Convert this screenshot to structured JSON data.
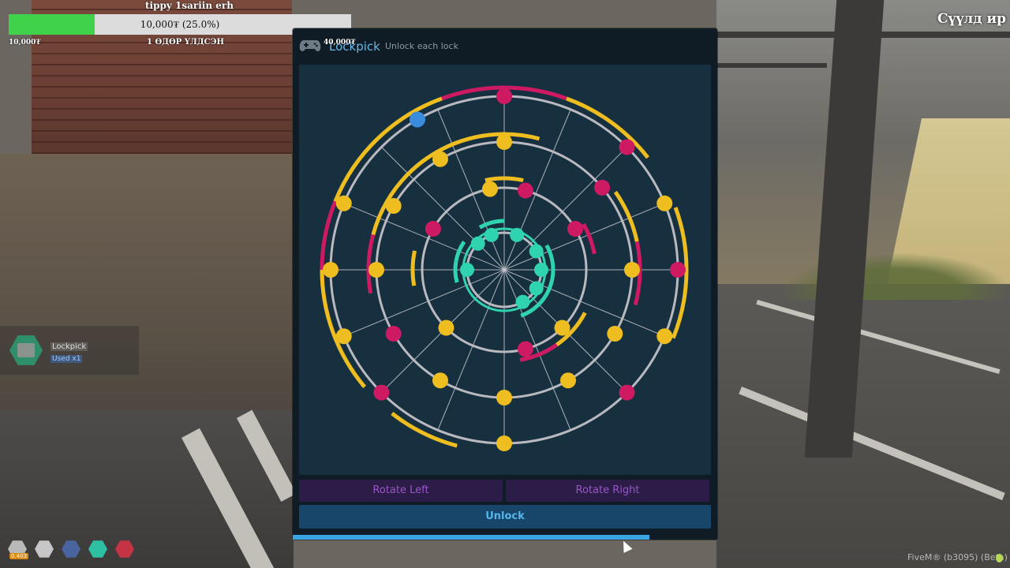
{
  "hud": {
    "player_name": "tippy 1sariin erh",
    "progress_text": "10,000₮ (25.0%)",
    "progress_fraction": 0.25,
    "left_amount": "10,000₮",
    "right_amount": "40,000₮",
    "sub_label": "1 ӨДӨР ҮЛДСЭН",
    "top_right_label": "Сүүлд ир"
  },
  "notification": {
    "item_name": "Lockpick",
    "item_action": "Used x1"
  },
  "status_bar": {
    "badge": "0.403",
    "icons": [
      "house-icon",
      "box-icon",
      "shield-icon",
      "drop-icon",
      "brain-icon"
    ],
    "colors": [
      "#b9b9b9",
      "#c6c6c6",
      "#4a64a0",
      "#2fbfa3",
      "#c43445"
    ]
  },
  "watermark": "FiveM® (b3095) (Beta)",
  "panel": {
    "title": "Lockpick",
    "subtitle": "Unlock each lock",
    "buttons": {
      "rotate_left": "Rotate Left",
      "rotate_right": "Rotate Right",
      "unlock": "Unlock"
    },
    "timer_fraction": 0.84,
    "colors": {
      "yellow": "#eebd1f",
      "magenta": "#cd1a63",
      "blue": "#3a8ddc",
      "teal": "#2fd3b0",
      "ring": "#b9b9bf",
      "spoke": "#c9c9cf"
    }
  },
  "lock": {
    "rings": [
      {
        "pins": [
          {
            "angle": 270,
            "color": "magenta"
          },
          {
            "angle": 315,
            "color": "magenta"
          },
          {
            "angle": 337.5,
            "color": "yellow"
          },
          {
            "angle": 0,
            "color": "magenta"
          },
          {
            "angle": 22.5,
            "color": "yellow"
          },
          {
            "angle": 45,
            "color": "magenta"
          },
          {
            "angle": 90,
            "color": "yellow"
          },
          {
            "angle": 135,
            "color": "magenta"
          },
          {
            "angle": 157.5,
            "color": "yellow"
          },
          {
            "angle": 180,
            "color": "yellow"
          },
          {
            "angle": 202.5,
            "color": "yellow"
          },
          {
            "angle": 240,
            "color": "blue"
          }
        ],
        "arcs": [
          {
            "start": 250,
            "end": 290,
            "color": "magenta"
          },
          {
            "start": 290,
            "end": 322,
            "color": "yellow"
          },
          {
            "start": 202,
            "end": 250,
            "color": "yellow"
          },
          {
            "start": 165,
            "end": 202,
            "color": "magenta"
          },
          {
            "start": 140,
            "end": 180,
            "color": "yellow"
          },
          {
            "start": 340,
            "end": 22,
            "color": "yellow"
          },
          {
            "start": 105,
            "end": 128,
            "color": "yellow"
          }
        ]
      },
      {
        "pins": [
          {
            "angle": 270,
            "color": "yellow"
          },
          {
            "angle": 320,
            "color": "magenta"
          },
          {
            "angle": 0,
            "color": "yellow"
          },
          {
            "angle": 30,
            "color": "yellow"
          },
          {
            "angle": 60,
            "color": "yellow"
          },
          {
            "angle": 90,
            "color": "yellow"
          },
          {
            "angle": 120,
            "color": "yellow"
          },
          {
            "angle": 150,
            "color": "magenta"
          },
          {
            "angle": 180,
            "color": "yellow"
          },
          {
            "angle": 210,
            "color": "yellow"
          },
          {
            "angle": 240,
            "color": "yellow"
          }
        ],
        "arcs": [
          {
            "start": 195,
            "end": 285,
            "color": "yellow"
          },
          {
            "start": 170,
            "end": 195,
            "color": "magenta"
          },
          {
            "start": 325,
            "end": 348,
            "color": "yellow"
          },
          {
            "start": 348,
            "end": 15,
            "color": "magenta"
          }
        ]
      },
      {
        "pins": [
          {
            "angle": 260,
            "color": "yellow"
          },
          {
            "angle": 285,
            "color": "magenta"
          },
          {
            "angle": 330,
            "color": "magenta"
          },
          {
            "angle": 45,
            "color": "yellow"
          },
          {
            "angle": 75,
            "color": "magenta"
          },
          {
            "angle": 135,
            "color": "yellow"
          },
          {
            "angle": 210,
            "color": "magenta"
          }
        ],
        "arcs": [
          {
            "start": 258,
            "end": 282,
            "color": "yellow"
          },
          {
            "start": 330,
            "end": 350,
            "color": "magenta"
          },
          {
            "start": 28,
            "end": 55,
            "color": "yellow"
          },
          {
            "start": 55,
            "end": 80,
            "color": "magenta"
          },
          {
            "start": 170,
            "end": 192,
            "color": "yellow"
          }
        ]
      },
      {
        "pins": [
          {
            "angle": 250,
            "color": "teal"
          },
          {
            "angle": 225,
            "color": "teal"
          },
          {
            "angle": 180,
            "color": "teal"
          },
          {
            "angle": 290,
            "color": "teal"
          },
          {
            "angle": 330,
            "color": "teal"
          },
          {
            "angle": 0,
            "color": "teal"
          },
          {
            "angle": 30,
            "color": "teal"
          },
          {
            "angle": 60,
            "color": "teal"
          }
        ],
        "arcs": [
          {
            "start": 240,
            "end": 270,
            "color": "teal"
          },
          {
            "start": 190,
            "end": 215,
            "color": "teal"
          },
          {
            "start": 165,
            "end": 190,
            "color": "teal"
          },
          {
            "start": 330,
            "end": 70,
            "color": "teal"
          }
        ]
      }
    ]
  }
}
